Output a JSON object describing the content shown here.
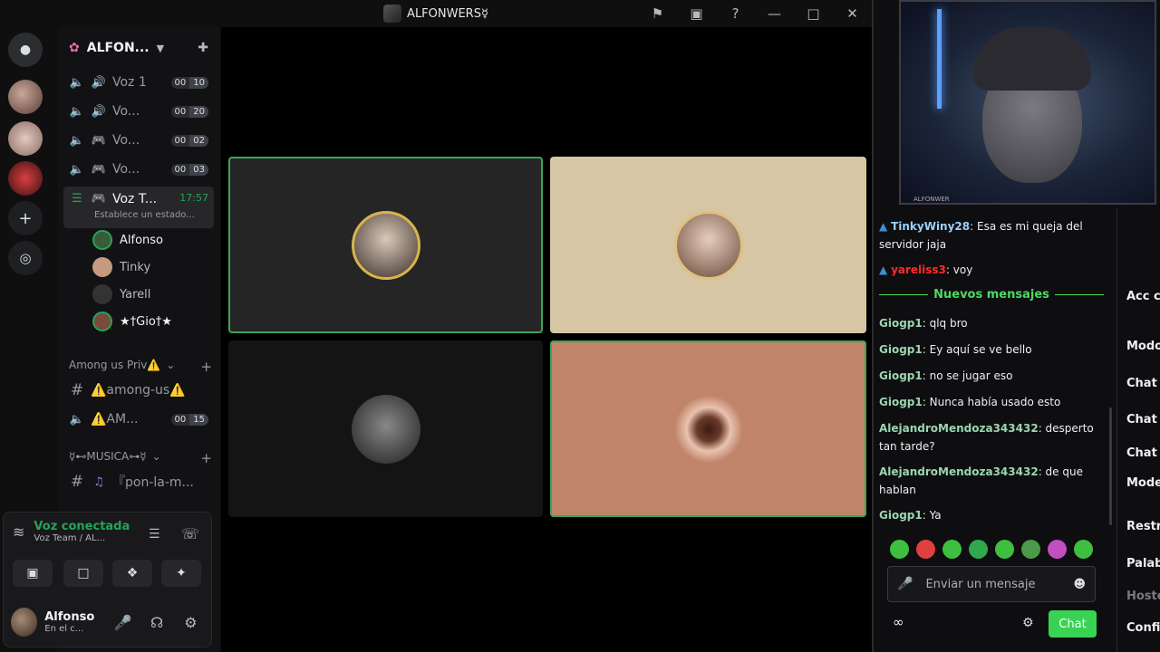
{
  "window": {
    "title": "ALFONWERS☿"
  },
  "title_icons": [
    "⚑",
    "▣",
    "?",
    "—",
    "□",
    "✕"
  ],
  "server": {
    "name": "ALFON..."
  },
  "channels": [
    {
      "name": "Voz 1",
      "c1": "00",
      "c2": "10"
    },
    {
      "name": "Vo...",
      "c1": "00",
      "c2": "20"
    },
    {
      "name": "Vo...",
      "c1": "00",
      "c2": "02"
    },
    {
      "name": "Vo...",
      "c1": "00",
      "c2": "03"
    }
  ],
  "active_channel": {
    "name": "Voz T...",
    "time": "17:57",
    "status": "Establece un estado..."
  },
  "members": [
    "Alfonso",
    "Tinky",
    "Yarell",
    "★†Gio†★"
  ],
  "categories": {
    "among": {
      "label": "Among us Priv⚠️",
      "text_channel": "⚠️among-us⚠️",
      "voice_channel": "⚠️AM...",
      "c1": "00",
      "c2": "15"
    },
    "musica": {
      "label": "☿⊷MUSICA⊶☿",
      "text_channel": "『pon-la-m...",
      "cut_channel": "『"
    }
  },
  "voice_panel": {
    "status": "Voz conectada",
    "location": "Voz Team / AL..."
  },
  "user": {
    "name": "Alfonso",
    "status": "En el c..."
  },
  "chat": {
    "messages_top": [
      {
        "user": "TinkyWiny28",
        "color": "#9ad0ff",
        "text": ": Esa es mi queja del servidor jaja"
      },
      {
        "user": "yareliss3",
        "color": "#ff2a2a",
        "text": ": voy"
      }
    ],
    "divider": "Nuevos mensajes",
    "messages": [
      {
        "user": "Giogp1",
        "color": "#9bd6b0",
        "text": ": qlq bro"
      },
      {
        "user": "Giogp1",
        "color": "#9bd6b0",
        "text": ": Ey aquí se ve bello"
      },
      {
        "user": "Giogp1",
        "color": "#9bd6b0",
        "text": ": no se jugar eso"
      },
      {
        "user": "Giogp1",
        "color": "#9bd6b0",
        "text": ": Nunca había usado esto"
      },
      {
        "user": "AlejandroMendoza343432",
        "color": "#9bd6b0",
        "text": ": desperto tan tarde?"
      },
      {
        "user": "AlejandroMendoza343432",
        "color": "#9bd6b0",
        "text": ": de que hablan"
      },
      {
        "user": "Giogp1",
        "color": "#9bd6b0",
        "text": ": Ya"
      }
    ],
    "placeholder": "Enviar un mensaje",
    "send_label": "Chat",
    "cam_tag": "ALFONWER"
  },
  "mod_panel": [
    "Acc car",
    "Modo",
    "Chat c",
    "Chat c",
    "Chat c",
    "Mode con IA",
    "Restri",
    "Palab",
    "Hoste",
    "Config"
  ],
  "colors": {
    "accent": "#3ba55c",
    "twitch_green": "#39d353"
  }
}
